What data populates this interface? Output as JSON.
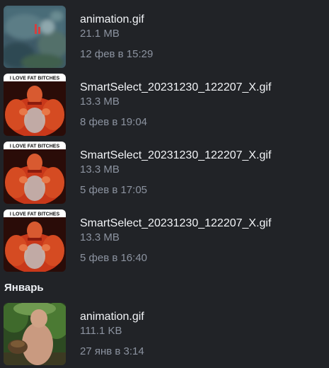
{
  "files_feb": [
    {
      "name": "animation.gif",
      "size": "21.1 MB",
      "date": "12 фев в 15:29",
      "thumb": "blurred-game-screenshot"
    },
    {
      "name": "SmartSelect_20231230_122207_X.gif",
      "size": "13.3 MB",
      "date": "8 фев в 19:04",
      "thumb": "muscular-man-meme",
      "caption": "I LOVE FAT BITCHES"
    },
    {
      "name": "SmartSelect_20231230_122207_X.gif",
      "size": "13.3 MB",
      "date": "5 фев в 17:05",
      "thumb": "muscular-man-meme",
      "caption": "I LOVE FAT BITCHES"
    },
    {
      "name": "SmartSelect_20231230_122207_X.gif",
      "size": "13.3 MB",
      "date": "5 фев в 16:40",
      "thumb": "muscular-man-meme",
      "caption": "I LOVE FAT BITCHES"
    }
  ],
  "month_header": "Январь",
  "files_jan": [
    {
      "name": "animation.gif",
      "size": "111.1 KB",
      "date": "27 янв в 3:14",
      "thumb": "man-outdoors-photo"
    }
  ],
  "colors": {
    "background": "#212327",
    "primary_text": "#f2f4f7",
    "secondary_text": "#8c93a0"
  }
}
